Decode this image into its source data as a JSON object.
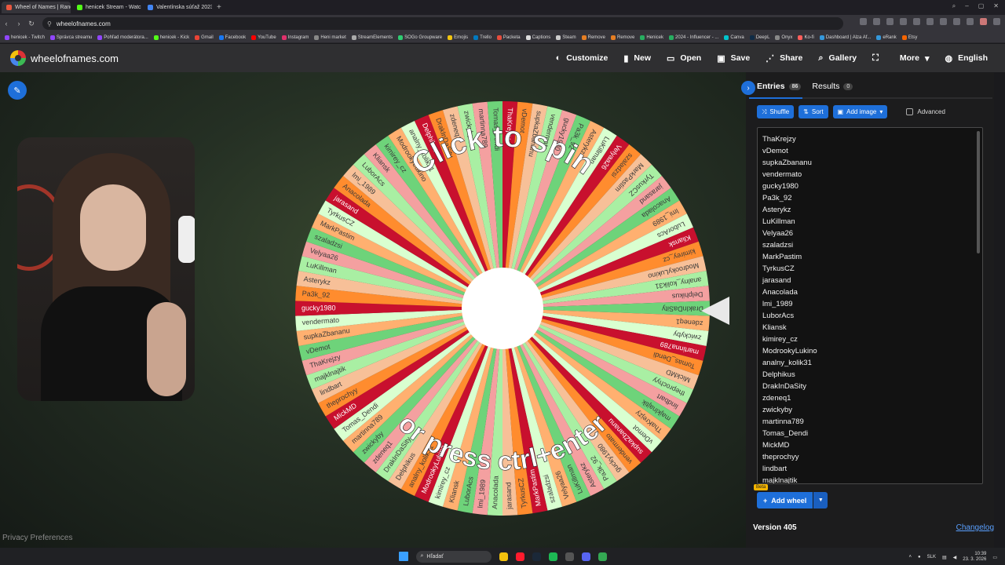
{
  "browser": {
    "tabs": [
      {
        "label": "Wheel of Names | Rando",
        "color": "#e9573f",
        "active": true
      },
      {
        "label": "henicek Stream - Watch L",
        "color": "#53fc18",
        "active": false
      },
      {
        "label": "Valentínska súťaž 2023 - I",
        "color": "#4285f4",
        "active": false
      }
    ],
    "url": "wheelofnames.com",
    "bookmarks": [
      {
        "label": "henicek - Twitch",
        "color": "#9146ff"
      },
      {
        "label": "Správca streamu",
        "color": "#9146ff"
      },
      {
        "label": "Pohľad moderátora...",
        "color": "#9146ff"
      },
      {
        "label": "henicek - Kick",
        "color": "#53fc18"
      },
      {
        "label": "Gmail",
        "color": "#ea4335"
      },
      {
        "label": "Facebook",
        "color": "#1877f2"
      },
      {
        "label": "YouTube",
        "color": "#ff0000"
      },
      {
        "label": "Instagram",
        "color": "#e1306c"
      },
      {
        "label": "Heni market",
        "color": "#888888"
      },
      {
        "label": "StreamElements",
        "color": "#aaaaaa"
      },
      {
        "label": "SOGo Groupware",
        "color": "#2ecc71"
      },
      {
        "label": "Emojis",
        "color": "#f1c40f"
      },
      {
        "label": "Trello",
        "color": "#0079bf"
      },
      {
        "label": "Packeta",
        "color": "#e74c3c"
      },
      {
        "label": "Captions",
        "color": "#dddddd"
      },
      {
        "label": "Steam",
        "color": "#cccccc"
      },
      {
        "label": "Remove",
        "color": "#e67e22"
      },
      {
        "label": "Remove",
        "color": "#e67e22"
      },
      {
        "label": "Henicek",
        "color": "#27ae60"
      },
      {
        "label": "2024 - Influencer - ...",
        "color": "#27ae60"
      },
      {
        "label": "Canva",
        "color": "#00c4cc"
      },
      {
        "label": "DeepL",
        "color": "#0f2b46"
      },
      {
        "label": "Onyx",
        "color": "#888888"
      },
      {
        "label": "Ko-fi",
        "color": "#ff5e5b"
      },
      {
        "label": "Dashboard | Alza Af...",
        "color": "#3498db"
      },
      {
        "label": "eRank",
        "color": "#3498db"
      },
      {
        "label": "Etsy",
        "color": "#f56400"
      }
    ]
  },
  "app": {
    "name": "wheelofnames.com",
    "menu": [
      {
        "label": "Customize",
        "icon": "palette-icon",
        "glyph": "◐"
      },
      {
        "label": "New",
        "icon": "file-icon",
        "glyph": "▮"
      },
      {
        "label": "Open",
        "icon": "folder-icon",
        "glyph": "▭"
      },
      {
        "label": "Save",
        "icon": "save-icon",
        "glyph": "▣"
      },
      {
        "label": "Share",
        "icon": "share-icon",
        "glyph": "⋰"
      },
      {
        "label": "Gallery",
        "icon": "search-icon",
        "glyph": "⌕"
      },
      {
        "label": "",
        "icon": "fullscreen-icon",
        "glyph": "⛶"
      },
      {
        "label": "More",
        "icon": "chevron-down-icon",
        "glyph": "▾"
      },
      {
        "label": "English",
        "icon": "globe-icon",
        "glyph": "◍"
      }
    ]
  },
  "wheel": {
    "text_top": "Click to spin",
    "text_bottom": "or press ctrl+enter",
    "colors": [
      "#c8102e",
      "#ff8c2e",
      "#f7c098",
      "#a9efa3",
      "#f4a0a0",
      "#6ed37a",
      "#ffb070",
      "#d9ffd0"
    ],
    "slice_labels": [
      "ThaKrejzy",
      "vDemot",
      "supkaZbananu",
      "vendermato",
      "gucky1980",
      "Pa3k_92",
      "Asterykz",
      "LuKillman",
      "Velyaa26",
      "szaladzsi",
      "MarkPastim",
      "TyrkusCZ",
      "jarasand",
      "Anacolada",
      "lmi_1989",
      "LuborAcs",
      "Kliansk",
      "kimirey_cz",
      "ModrookyLukino",
      "analny_kolik31",
      "Delphikus",
      "DrakInDaSity",
      "zdeneq1",
      "zwickyby",
      "martinna789",
      "Tomas_Dendi",
      "MickMD",
      "theprochyy",
      "lindbart",
      "majklnajtik"
    ],
    "selected_label": "len_Andrej"
  },
  "privacy": "Privacy Preferences",
  "panel": {
    "tabs": [
      {
        "label": "Entries",
        "count": "86"
      },
      {
        "label": "Results",
        "count": "0"
      }
    ],
    "toolbar": {
      "shuffle": "Shuffle",
      "sort": "Sort",
      "add_image": "Add image",
      "advanced": "Advanced"
    },
    "entries": [
      "ThaKrejzy",
      "vDemot",
      "supkaZbananu",
      "vendermato",
      "gucky1980",
      "Pa3k_92",
      "Asterykz",
      "LuKillman",
      "Velyaa26",
      "szaladzsi",
      "MarkPastim",
      "TyrkusCZ",
      "jarasand",
      "Anacolada",
      "lmi_1989",
      "LuborAcs",
      "Kliansk",
      "kimirey_cz",
      "ModrookyLukino",
      "analny_kolik31",
      "Delphikus",
      "DrakInDaSity",
      "zdeneq1",
      "zwickyby",
      "martinna789",
      "Tomas_Dendi",
      "MickMD",
      "theprochyy",
      "lindbart",
      "majklnajtik"
    ],
    "add_wheel": "Add wheel",
    "beta": "Beta",
    "version": "Version 405",
    "changelog": "Changelog"
  },
  "taskbar": {
    "search": "Hľadať",
    "lang": "SLK",
    "time": "10:39",
    "date": "23. 3. 2026",
    "apps": [
      {
        "name": "explorer-icon",
        "color": "#f4c20d"
      },
      {
        "name": "opera-icon",
        "color": "#ff1b2d"
      },
      {
        "name": "steam-icon",
        "color": "#1b2838"
      },
      {
        "name": "spotify-icon",
        "color": "#1db954"
      },
      {
        "name": "xbox-icon",
        "color": "#555555"
      },
      {
        "name": "discord-icon",
        "color": "#5865f2"
      },
      {
        "name": "chrome-icon",
        "color": "#34a853"
      }
    ]
  }
}
